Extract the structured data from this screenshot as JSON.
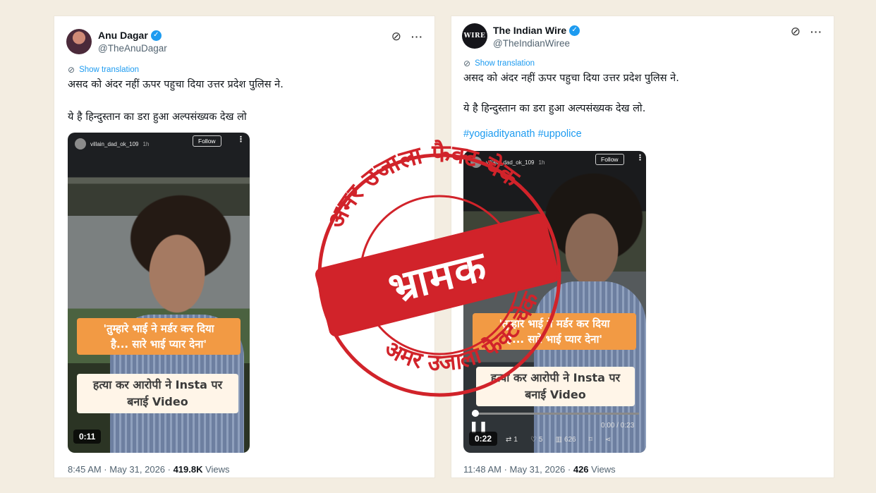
{
  "tweet1": {
    "name": "Anu Dagar",
    "handle": "@TheAnuDagar",
    "show_translation": "Show translation",
    "text_line1": "असद को अंदर नहीं ऊपर पहुचा दिया उत्तर प्रदेश पुलिस ने.",
    "text_line2": "ये है हिन्दुस्तान का डरा हुआ अल्पसंख्यक देख लो",
    "video": {
      "username": "villain_dad_ok_109",
      "age": "1h",
      "follow": "Follow",
      "caption1_line1": "'तुम्हारे भाई ने मर्डर कर दिया",
      "caption1_line2": "है... सारे भाई प्यार देना'",
      "caption2_line1": "हत्या कर आरोपी ने Insta पर",
      "caption2_line2": "बनाई Video",
      "duration": "0:11"
    },
    "time": "8:45 AM · May 31, 2026 · ",
    "views_count": "419.8K",
    "views_label": " Views"
  },
  "tweet2": {
    "name": "The Indian Wire",
    "avatar_text": "WIRE",
    "handle": "@TheIndianWiree",
    "show_translation": "Show translation",
    "text_line1": "असद को अंदर नहीं ऊपर पहुचा दिया उत्तर प्रदेश पुलिस ने.",
    "text_line2": "ये है हिन्दुस्तान का डरा हुआ अल्पसंख्यक देख लो.",
    "hashtags": "#yogiadityanath #uppolice",
    "video": {
      "username": "villain_dad_ok_109",
      "age": "1h",
      "follow": "Follow",
      "caption1_line1": "'तुम्हारे भाई ने मर्डर कर दिया",
      "caption1_line2": "है... सारे भाई प्यार देना'",
      "caption2_line1": "हत्या कर आरोपी ने Insta पर",
      "caption2_line2": "बनाई Video",
      "player_time": "0:00 / 0:23",
      "duration": "0:22",
      "progress": 0.03,
      "retweets": "1",
      "likes": "5",
      "views": "626"
    },
    "time": "11:48 AM · May 31, 2026 · ",
    "views_count": "426",
    "views_label": " Views"
  },
  "stamp": {
    "ring_text": "अमर उजाला फैक्ट चेक",
    "verdict": "भ्रामक",
    "color": "#d1232a"
  },
  "colors": {
    "background": "#f3ede1",
    "link": "#1d9bf0",
    "secondary_text": "#536471",
    "caption_orange": "#f29a44"
  },
  "icons": [
    "verified-badge-icon",
    "grok-icon",
    "more-icon",
    "translate-icon",
    "pause-icon",
    "retweet-icon",
    "like-icon",
    "views-icon",
    "bookmark-icon",
    "share-icon"
  ]
}
